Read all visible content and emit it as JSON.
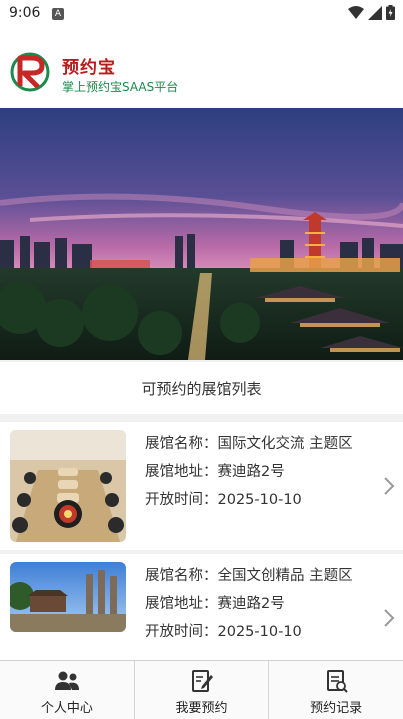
{
  "status_bar": {
    "time": "9:06",
    "notification_badge": "A"
  },
  "header": {
    "brand_name": "预约宝",
    "brand_subtitle": "掌上预约宝SAAS平台",
    "accent_green": "#1b8a4b",
    "accent_red": "#b71c1c"
  },
  "list_title": "可预约的展馆列表",
  "venues": [
    {
      "name_label": "展馆名称：国际文化交流 主题区",
      "address_label": "展馆地址：赛迪路2号",
      "open_time_label": "开放时间：2025-10-10"
    },
    {
      "name_label": "展馆名称：全国文创精品 主题区",
      "address_label": "展馆地址：赛迪路2号",
      "open_time_label": "开放时间：2025-10-10"
    }
  ],
  "tabbar": {
    "tabs": [
      {
        "label": "个人中心",
        "icon": "users-icon"
      },
      {
        "label": "我要预约",
        "icon": "edit-document-icon"
      },
      {
        "label": "预约记录",
        "icon": "records-icon"
      }
    ]
  }
}
